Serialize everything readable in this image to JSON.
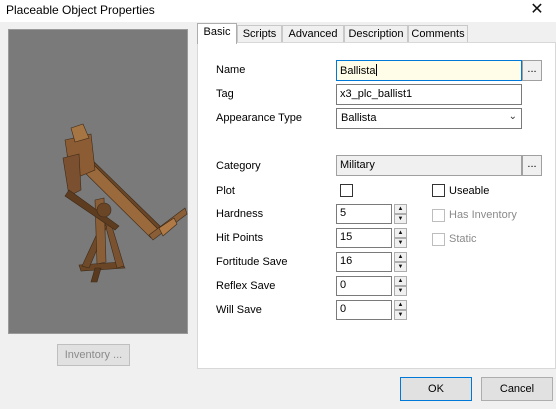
{
  "window": {
    "title": "Placeable Object Properties",
    "close_glyph": "✕"
  },
  "left": {
    "inventory_label": "Inventory ..."
  },
  "tabs": [
    {
      "label": "Basic",
      "active": true
    },
    {
      "label": "Scripts",
      "active": false
    },
    {
      "label": "Advanced",
      "active": false
    },
    {
      "label": "Description",
      "active": false
    },
    {
      "label": "Comments",
      "active": false
    }
  ],
  "basic": {
    "name_label": "Name",
    "name_value": "Ballista",
    "tag_label": "Tag",
    "tag_value": "x3_plc_ballist1",
    "appearance_label": "Appearance Type",
    "appearance_value": "Ballista",
    "category_label": "Category",
    "category_value": "Military",
    "browse_label": "...",
    "plot_label": "Plot",
    "plot_checked": false,
    "useable_label": "Useable",
    "useable_checked": false,
    "has_inventory_label": "Has Inventory",
    "has_inventory_checked": false,
    "static_label": "Static",
    "static_checked": false,
    "hardness_label": "Hardness",
    "hardness_value": "5",
    "hitpoints_label": "Hit Points",
    "hitpoints_value": "15",
    "fortitude_label": "Fortitude Save",
    "fortitude_value": "16",
    "reflex_label": "Reflex Save",
    "reflex_value": "0",
    "will_label": "Will Save",
    "will_value": "0"
  },
  "footer": {
    "ok_label": "OK",
    "cancel_label": "Cancel"
  },
  "colors": {
    "preview_bg": "#7a7a7a",
    "accent": "#0078d7",
    "name_field_bg": "#fffde7"
  }
}
